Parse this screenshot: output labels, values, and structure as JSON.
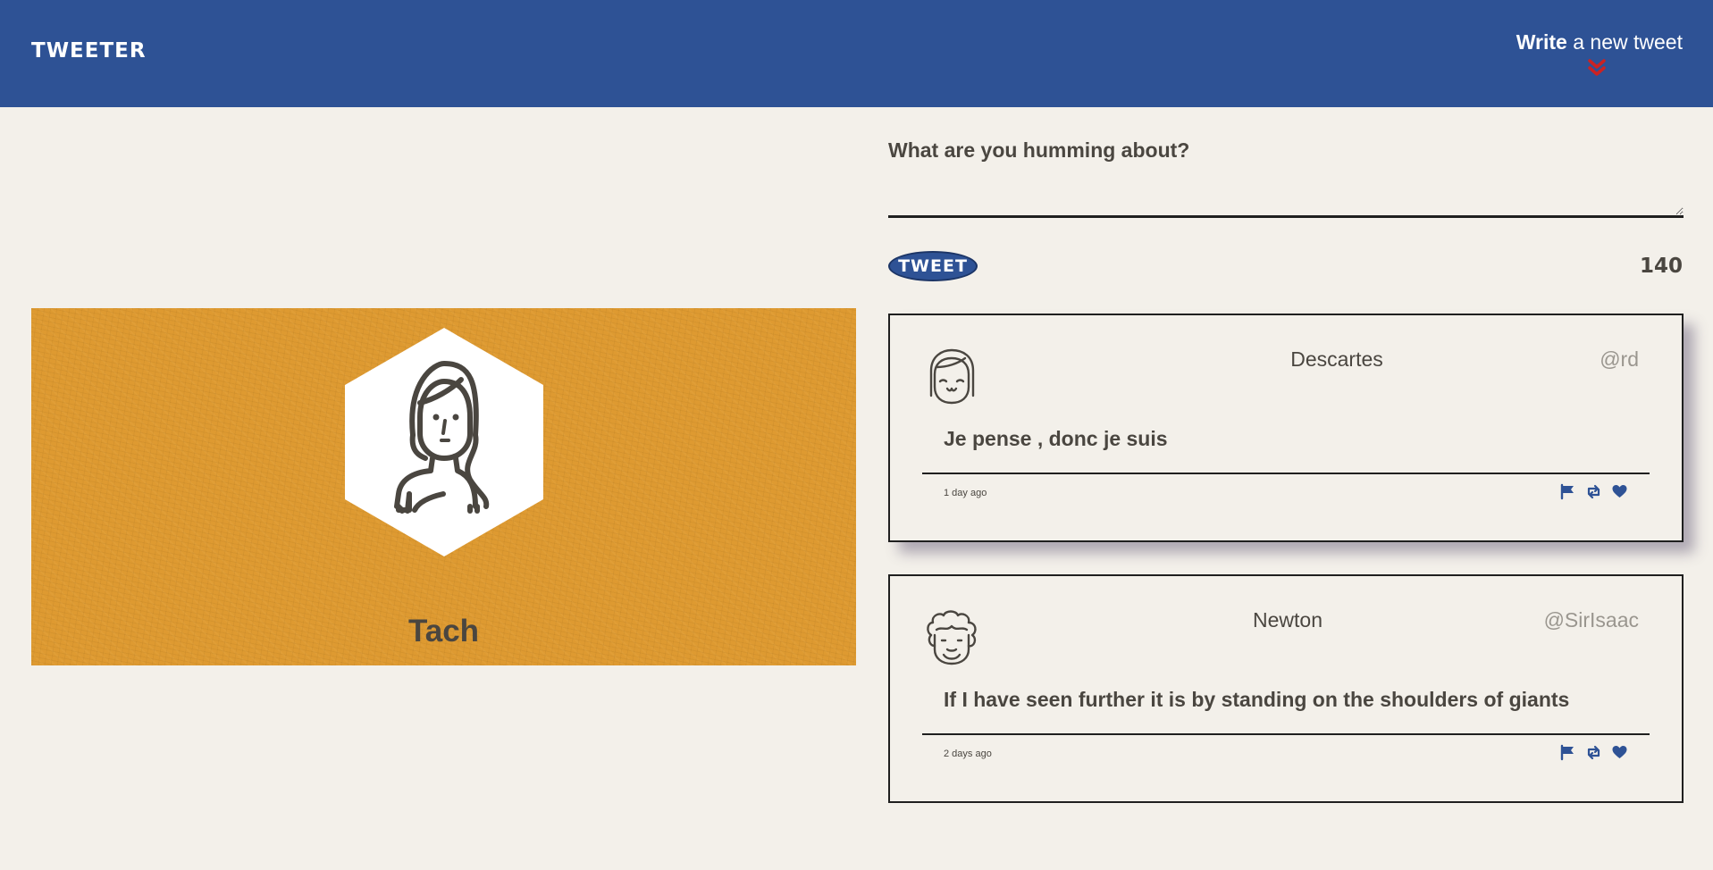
{
  "navbar": {
    "brand": "TWEETER",
    "write_bold": "Write",
    "write_rest": " a new tweet",
    "chevron_icon": "double-chevron-down-icon",
    "chevron_color": "#cc2222",
    "background": "#2e5295"
  },
  "profile": {
    "name": "Tach",
    "background": "#de9a31",
    "avatar_icon": "woman-avatar-icon"
  },
  "compose": {
    "label": "What are you humming about?",
    "value": "",
    "button_label": "TWEET",
    "counter": "140"
  },
  "tweets": [
    {
      "author": "Descartes",
      "handle": "@rd",
      "content": "Je pense , donc je suis",
      "time": "1 day ago",
      "avatar_icon": "girl-avatar-icon"
    },
    {
      "author": "Newton",
      "handle": "@SirIsaac",
      "content": "If I have seen further it is by standing on the shoulders of giants",
      "time": "2 days ago",
      "avatar_icon": "curly-hair-avatar-icon"
    }
  ],
  "actions": [
    "flag-icon",
    "retweet-icon",
    "heart-icon"
  ],
  "colors": {
    "accent": "#2e5295",
    "text": "#4a4640",
    "page": "#f3f0ea"
  }
}
